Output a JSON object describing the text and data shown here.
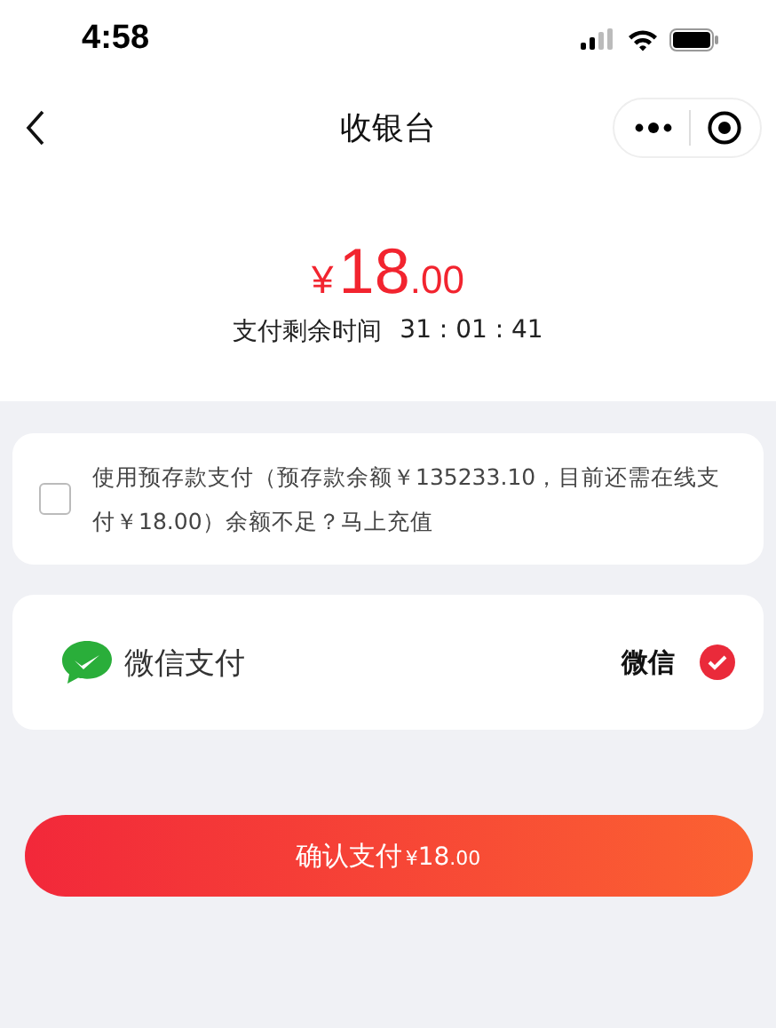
{
  "status_bar": {
    "time": "4:58"
  },
  "nav": {
    "title": "收银台"
  },
  "amount": {
    "currency": "¥",
    "integer": "18",
    "decimal": ".00"
  },
  "countdown": {
    "label": "支付剩余时间",
    "time": "31 : 01 : 41"
  },
  "deposit": {
    "checked": false,
    "text": "使用预存款支付（预存款余额￥135233.10，目前还需在线支付￥18.00）余额不足？马上充值"
  },
  "payment_methods": [
    {
      "name": "微信支付",
      "tag": "微信",
      "selected": true
    }
  ],
  "confirm_button": {
    "label": "确认支付",
    "currency": "¥",
    "integer": "18",
    "decimal": ".00"
  }
}
